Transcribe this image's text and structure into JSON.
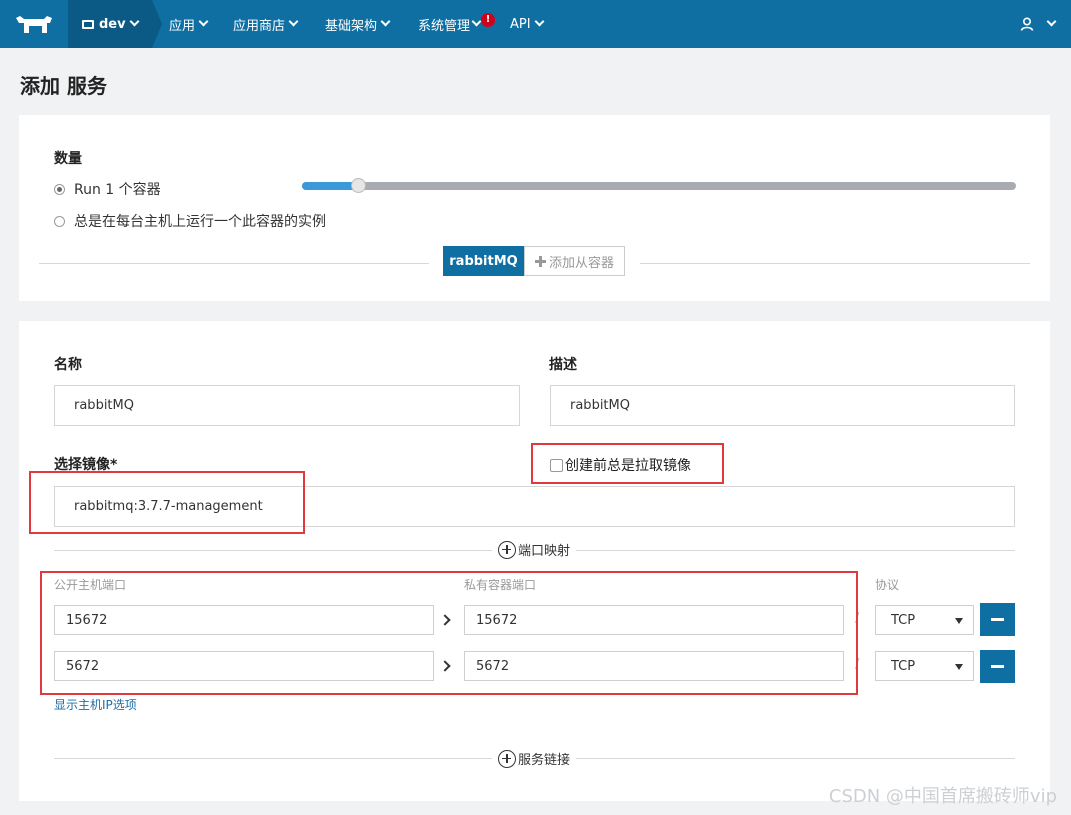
{
  "nav": {
    "environment": "dev",
    "items": [
      "应用",
      "应用商店",
      "基础架构",
      "系统管理",
      "API"
    ],
    "alert_badge": "!",
    "accent_color": "#0f6fa2"
  },
  "page": {
    "title": "添加 服务"
  },
  "scale": {
    "label": "数量",
    "option_run": "Run 1 个容器",
    "option_global": "总是在每台主机上运行一个此容器的实例",
    "selected": "run",
    "count": 1
  },
  "tabs": {
    "active": "rabbitMQ",
    "add_sidekick": "添加从容器"
  },
  "form": {
    "name_label": "名称",
    "name_value": "rabbitMQ",
    "desc_label": "描述",
    "desc_value": "rabbitMQ",
    "image_label": "选择镜像*",
    "image_value": "rabbitmq:3.7.7-management",
    "pull_label": "创建前总是拉取镜像",
    "pull_checked": false
  },
  "ports": {
    "section_label": "端口映射",
    "public_label": "公开主机端口",
    "private_label": "私有容器端口",
    "protocol_label": "协议",
    "rows": [
      {
        "public": "15672",
        "private": "15672",
        "protocol": "TCP"
      },
      {
        "public": "5672",
        "private": "5672",
        "protocol": "TCP"
      }
    ],
    "show_ip_link": "显示主机IP选项"
  },
  "links": {
    "section_label": "服务链接"
  },
  "watermark": "CSDN @中国首席搬砖师vip"
}
